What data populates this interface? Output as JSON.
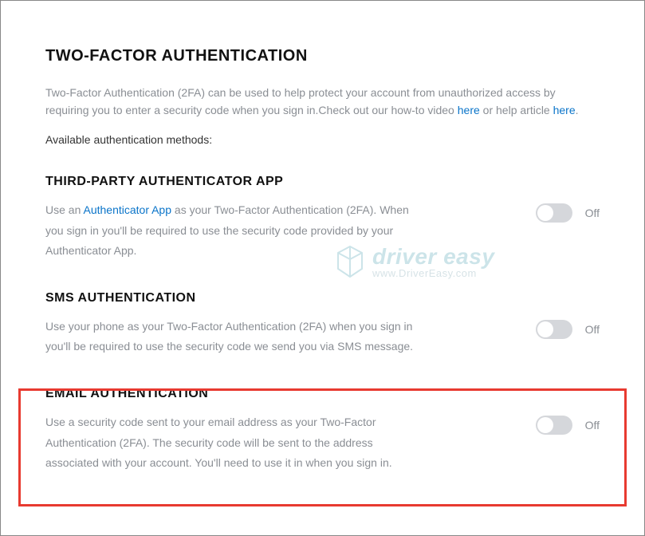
{
  "title": "TWO-FACTOR AUTHENTICATION",
  "intro_part1": "Two-Factor Authentication (2FA) can be used to help protect your account from unauthorized access by requiring you to enter a security code when you sign in.Check out our how-to video ",
  "intro_link1": "here",
  "intro_part2": " or help article ",
  "intro_link2": "here",
  "intro_part3": ".",
  "available_label": "Available authentication methods:",
  "methods": [
    {
      "title": "THIRD-PARTY AUTHENTICATOR APP",
      "desc_pre": "Use an ",
      "desc_link": "Authenticator App",
      "desc_post": " as your Two-Factor Authentication (2FA). When you sign in you'll be required to use the security code provided by your Authenticator App.",
      "state": "Off"
    },
    {
      "title": "SMS AUTHENTICATION",
      "desc_pre": "",
      "desc_link": "",
      "desc_post": "Use your phone as your Two-Factor Authentication (2FA) when you sign in you'll be required to use the security code we send you via SMS message.",
      "state": "Off"
    },
    {
      "title": "EMAIL AUTHENTICATION",
      "desc_pre": "",
      "desc_link": "",
      "desc_post": "Use a security code sent to your email address as your Two-Factor Authentication (2FA). The security code will be sent to the address associated with your account. You'll need to use it in when you sign in.",
      "state": "Off"
    }
  ],
  "watermark": {
    "main": "driver easy",
    "sub": "www.DriverEasy.com"
  }
}
